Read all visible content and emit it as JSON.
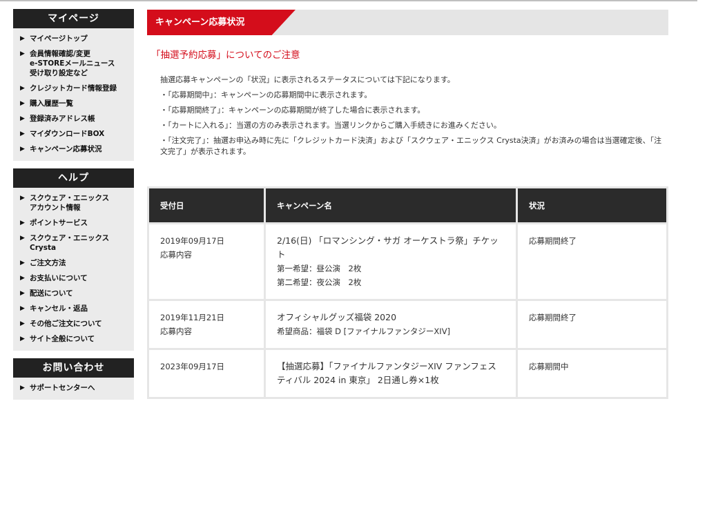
{
  "sidebar": {
    "mypage": {
      "heading": "マイページ",
      "items": [
        "マイページトップ",
        "会員情報確認/変更\ne-STOREメールニュース\n受け取り設定など",
        "クレジットカード情報登録",
        "購入履歴一覧",
        "登録済みアドレス帳",
        "マイダウンロードBOX",
        "キャンペーン応募状況"
      ]
    },
    "help": {
      "heading": "ヘルプ",
      "items": [
        "スクウェア・エニックス\nアカウント情報",
        "ポイントサービス",
        "スクウェア・エニックス\nCrysta",
        "ご注文方法",
        "お支払いについて",
        "配送について",
        "キャンセル・返品",
        "その他ご注文について",
        "サイト全般について"
      ]
    },
    "contact": {
      "heading": "お問い合わせ",
      "items": [
        "サポートセンターへ"
      ]
    }
  },
  "main": {
    "title": "キャンペーン応募状況",
    "notice_heading": "「抽選予約応募」についてのご注意",
    "notice_lines": [
      "抽選応募キャンペーンの「状況」に表示されるステータスについては下記になります。",
      "・「応募期間中」：キャンペーンの応募期間中に表示されます。",
      "・「応募期間終了」：キャンペーンの応募期間が終了した場合に表示されます。",
      "・「カートに入れる」：当選の方のみ表示されます。当選リンクからご購入手続きにお進みください。",
      "・「注文完了」：抽選お申込み時に先に「クレジットカード決済」および「スクウェア・エニックス Crysta決済」がお済みの場合は当選確定後、「注文完了」が表示されます。"
    ],
    "table": {
      "headers": {
        "date": "受付日",
        "name": "キャンペーン名",
        "status": "状況"
      },
      "rows": [
        {
          "date": "2019年09月17日",
          "sub": "応募内容",
          "name": "2/16(日) 「ロマンシング・サガ オーケストラ祭」チケット",
          "details": "第一希望：昼公演　2枚\n第二希望：夜公演　2枚",
          "status": "応募期間終了"
        },
        {
          "date": "2019年11月21日",
          "sub": "応募内容",
          "name": "オフィシャルグッズ福袋 2020",
          "details": "希望商品：福袋 D [ファイナルファンタジーXIV]",
          "status": "応募期間終了"
        },
        {
          "date": "2023年09月17日",
          "sub": "",
          "name": "【抽選応募】「ファイナルファンタジーXIV ファンフェスティバル 2024 in 東京」 2日通し券×1枚",
          "details": "",
          "status": "応募期間中"
        }
      ]
    }
  }
}
